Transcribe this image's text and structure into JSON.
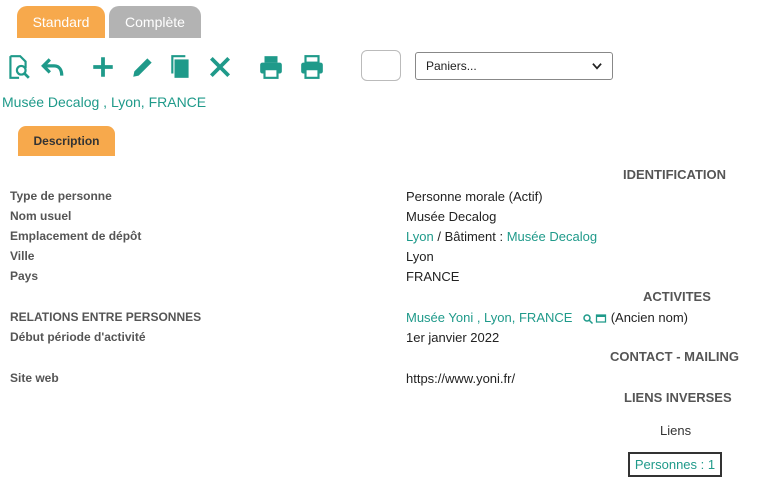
{
  "tabs": {
    "standard": "Standard",
    "complete": "Complète"
  },
  "toolbar": {
    "icons": [
      "search-document-icon",
      "undo-icon",
      "add-icon",
      "edit-icon",
      "copy-icon",
      "delete-icon",
      "print-icon",
      "print-alt-icon"
    ],
    "accent": "#1f9a8a"
  },
  "baskets": {
    "selected": "Paniers..."
  },
  "record_title": "Musée Decalog , Lyon, FRANCE",
  "description_tab": "Description",
  "sections": {
    "identification": "IDENTIFICATION",
    "activites": "ACTIVITES",
    "contact": "CONTACT - MAILING",
    "liens_inverses": "LIENS INVERSES"
  },
  "fields": {
    "type_label": "Type de personne",
    "type_value": "Personne morale (Actif)",
    "nom_label": "Nom usuel",
    "nom_value": "Musée Decalog",
    "emplacement_label": "Emplacement de dépôt",
    "emplacement_city": "Lyon",
    "emplacement_sep": "/  Bâtiment :",
    "emplacement_building": "Musée Decalog",
    "ville_label": "Ville",
    "ville_value": "Lyon",
    "pays_label": "Pays",
    "pays_value": "FRANCE",
    "relations_label": "RELATIONS ENTRE PERSONNES",
    "relations_link": "Musée Yoni , Lyon, FRANCE",
    "relations_suffix": "(Ancien nom)",
    "debut_label": "Début période d'activité",
    "debut_value": "1er janvier 2022",
    "site_label": "Site web",
    "site_value": "https://www.yoni.fr/"
  },
  "liens": {
    "label": "Liens",
    "persons": "Personnes : 1"
  }
}
